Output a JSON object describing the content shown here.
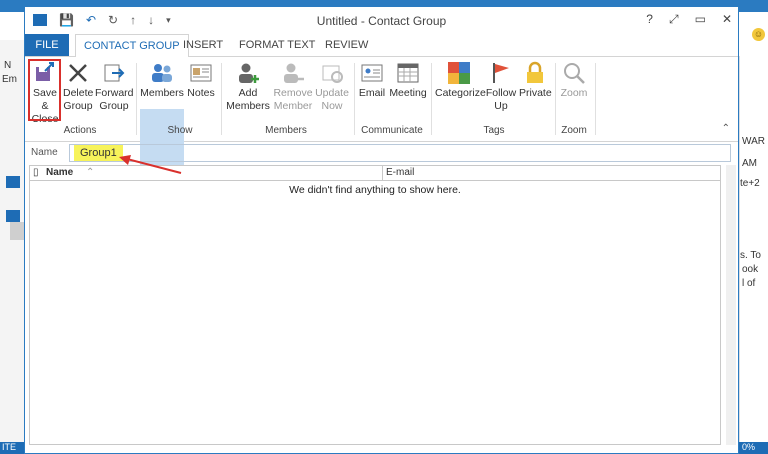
{
  "window": {
    "title": "Untitled - Contact Group",
    "controls": [
      "?",
      "⤢",
      "▭",
      "✕"
    ]
  },
  "qat": {
    "icons": [
      "outlook-icon",
      "save-icon",
      "undo-icon",
      "redo-icon",
      "up-icon",
      "down-icon",
      "customize-icon"
    ]
  },
  "tabs": [
    "FILE",
    "CONTACT GROUP",
    "INSERT",
    "FORMAT TEXT",
    "REVIEW"
  ],
  "ribbon": {
    "actions": {
      "save_close": "Save &\nClose",
      "delete_group": "Delete\nGroup",
      "forward_group": "Forward\nGroup",
      "label": "Actions"
    },
    "show": {
      "members": "Members",
      "notes": "Notes",
      "label": "Show"
    },
    "members": {
      "add_members": "Add\nMembers",
      "remove_member": "Remove\nMember",
      "update_now": "Update\nNow",
      "label": "Members"
    },
    "communicate": {
      "email": "Email",
      "meeting": "Meeting",
      "label": "Communicate"
    },
    "tags": {
      "categorize": "Categorize",
      "follow_up": "Follow\nUp",
      "private": "Private",
      "label": "Tags"
    },
    "zoom": {
      "zoom": "Zoom",
      "label": "Zoom"
    }
  },
  "form": {
    "name_label": "Name",
    "name_value": "Group1"
  },
  "list": {
    "col_name": "Name",
    "col_email": "E-mail",
    "empty_text": "We didn't find anything to show here."
  },
  "background": {
    "left_letters": [
      "N",
      "Em"
    ],
    "right_texts": [
      "WAR",
      "AM",
      "te+2",
      "s. To",
      "ook",
      "l of"
    ],
    "status_left": "ITE",
    "status_right": "0%"
  },
  "colors": {
    "accent": "#1e6cb5",
    "highlight_yellow": "#f7f35a",
    "annotation_red": "#d9302c",
    "selected_bg": "#c5dcf2"
  }
}
